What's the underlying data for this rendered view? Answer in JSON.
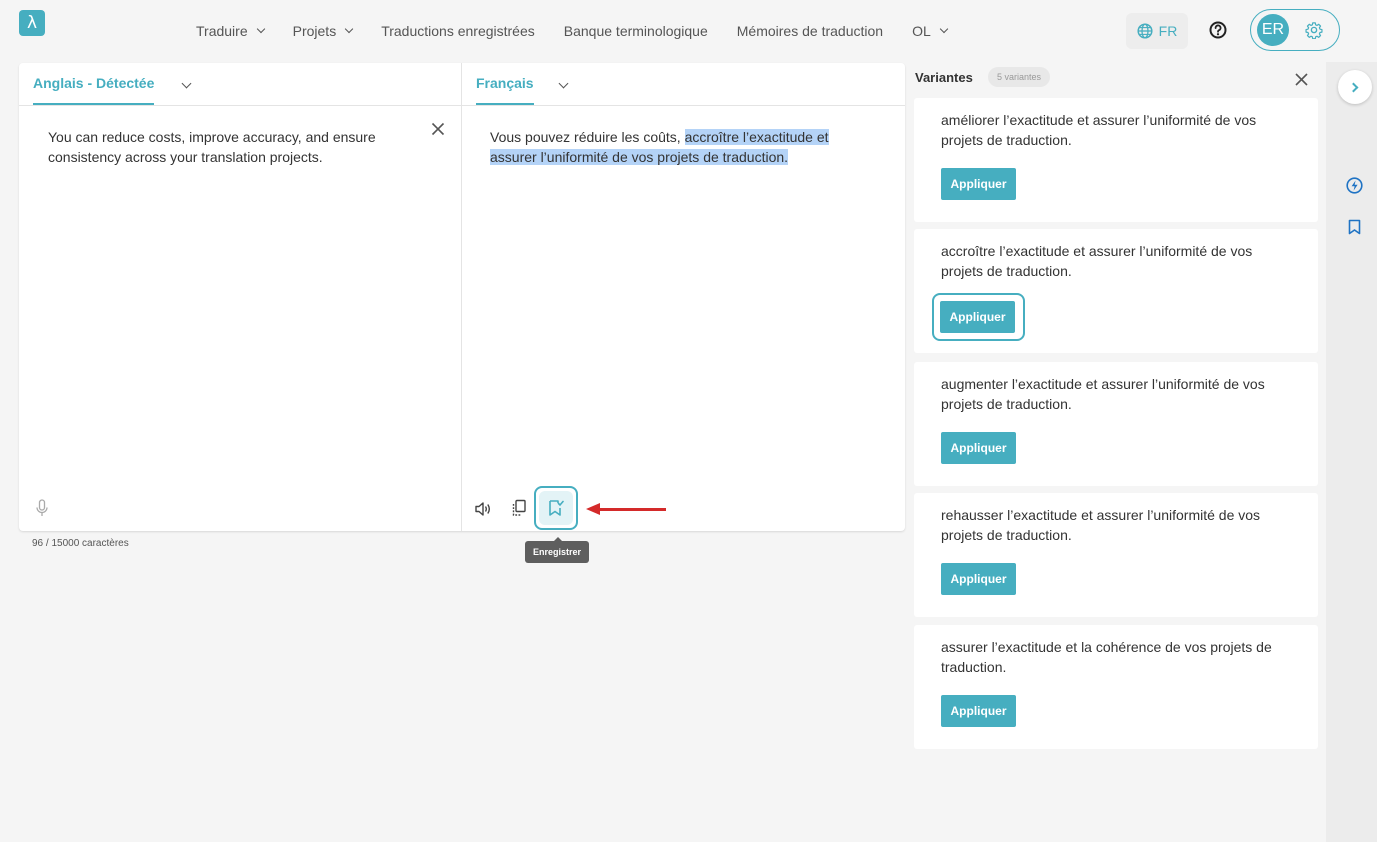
{
  "app": {
    "logo_text": "λ"
  },
  "nav": {
    "items": [
      {
        "label": "Traduire",
        "dropdown": true
      },
      {
        "label": "Projets",
        "dropdown": true
      },
      {
        "label": "Traductions enregistrées",
        "dropdown": false
      },
      {
        "label": "Banque terminologique",
        "dropdown": false
      },
      {
        "label": "Mémoires de traduction",
        "dropdown": false
      },
      {
        "label": "OL",
        "dropdown": true
      }
    ],
    "lang_label": "FR",
    "avatar_initials": "ER"
  },
  "source": {
    "lang_tab": "Anglais - Détectée",
    "text": "You can reduce costs, improve accuracy, and ensure consistency across your translation projects.",
    "char_count": "96 / 15000 caractères"
  },
  "target": {
    "lang_tab": "Français",
    "text_plain": "Vous pouvez réduire les coûts, ",
    "text_highlighted": "accroître l’exactitude et assurer l’uniformité de vos projets de traduction.",
    "save_tooltip": "Enregistrer"
  },
  "variants": {
    "title": "Variantes",
    "count_label": "5 variantes",
    "apply_label": "Appliquer",
    "items": [
      {
        "text": "améliorer l’exactitude et assurer l’uniformité de vos projets de traduction."
      },
      {
        "text": "accroître l’exactitude et assurer l’uniformité de vos projets de traduction."
      },
      {
        "text": "augmenter l’exactitude et assurer l’uniformité de vos projets de traduction."
      },
      {
        "text": "rehausser l’exactitude et assurer l’uniformité de vos projets de traduction."
      },
      {
        "text": "assurer l’exactitude et la cohérence de vos projets de traduction."
      }
    ]
  },
  "colors": {
    "accent": "#46aec0",
    "highlight": "#b4d3f7",
    "arrow": "#d42a2a"
  }
}
